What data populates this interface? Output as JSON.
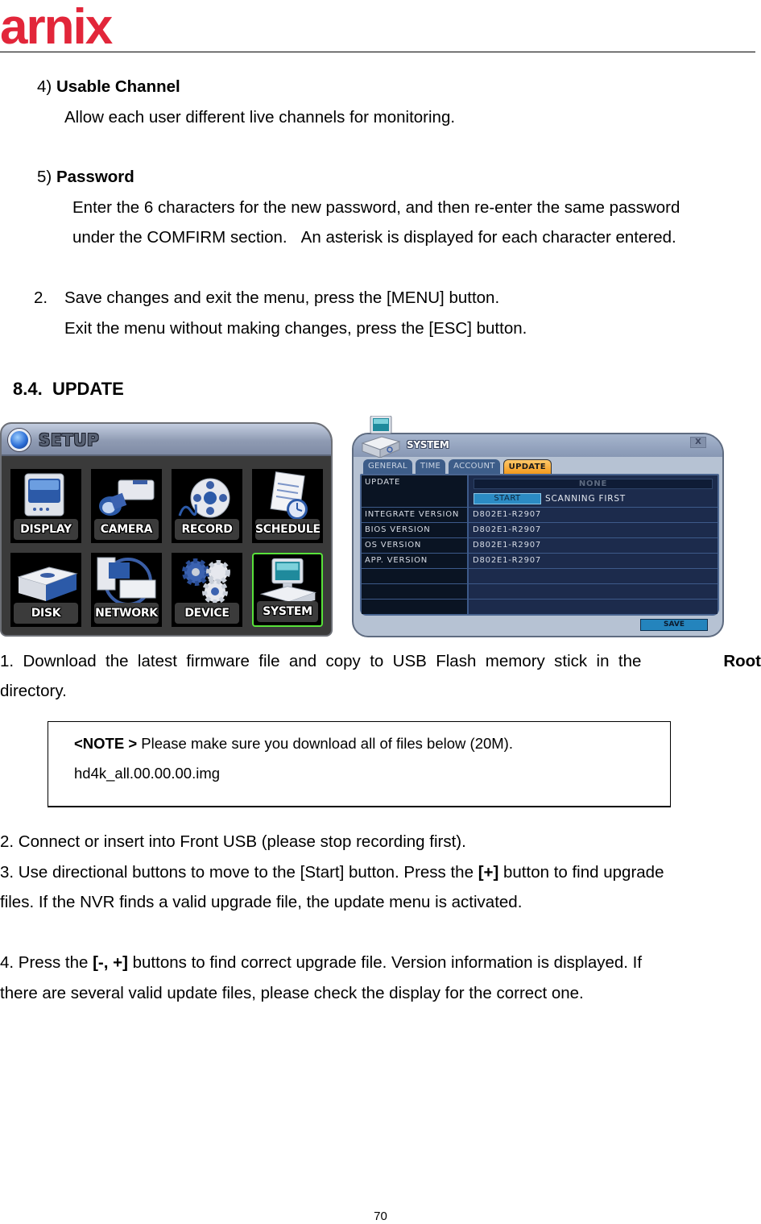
{
  "header": {
    "logo_text": "arnix",
    "brand_color": "#e2263a"
  },
  "sections": {
    "usable_channel": {
      "number": "4)",
      "title": "Usable Channel",
      "body": "Allow each user different live channels for monitoring."
    },
    "password": {
      "number": "5)",
      "title": "Password",
      "line1": "Enter the 6 characters for the new password, and then re-enter the same password",
      "line2": "under the COMFIRM section.   An asterisk is displayed for each character entered."
    },
    "step2_exit": {
      "number": "2.",
      "line1": "Save changes and exit the menu, press the [MENU] button.",
      "line2": "Exit the menu without making changes, press the [ESC] button."
    },
    "heading": {
      "number": "8.4.",
      "title": "UPDATE"
    }
  },
  "setup_menu": {
    "title": "SETUP",
    "items": [
      {
        "label": "DISPLAY",
        "icon": "monitor-icon",
        "selected": false
      },
      {
        "label": "CAMERA",
        "icon": "camera-icon",
        "selected": false
      },
      {
        "label": "RECORD",
        "icon": "film-reel-icon",
        "selected": false
      },
      {
        "label": "SCHEDULE",
        "icon": "schedule-clock-icon",
        "selected": false
      },
      {
        "label": "DISK",
        "icon": "disk-drive-icon",
        "selected": false
      },
      {
        "label": "NETWORK",
        "icon": "network-icon",
        "selected": false
      },
      {
        "label": "DEVICE",
        "icon": "gears-icon",
        "selected": false
      },
      {
        "label": "SYSTEM",
        "icon": "computer-icon",
        "selected": true
      }
    ],
    "selected_color": "#58e23a"
  },
  "system_dialog": {
    "title": "SYSTEM",
    "close_label": "X",
    "tabs": [
      {
        "label": "GENERAL",
        "active": false
      },
      {
        "label": "TIME",
        "active": false
      },
      {
        "label": "ACCOUNT",
        "active": false
      },
      {
        "label": "UPDATE",
        "active": true
      }
    ],
    "update": {
      "label": "UPDATE",
      "file_value": "NONE",
      "start_button": "START",
      "status": "SCANNING FIRST"
    },
    "rows": [
      {
        "label": "INTEGRATE VERSION",
        "value": "D802E1-R2907"
      },
      {
        "label": "BIOS VERSION",
        "value": "D802E1-R2907"
      },
      {
        "label": "OS VERSION",
        "value": "D802E1-R2907"
      },
      {
        "label": "APP. VERSION",
        "value": "D802E1-R2907"
      },
      {
        "label": "",
        "value": ""
      },
      {
        "label": "",
        "value": ""
      },
      {
        "label": "",
        "value": ""
      }
    ],
    "save_button": "SAVE",
    "active_tab_color": "#f39a1e"
  },
  "steps": {
    "step1": {
      "line1_prefix": "1.  Download  the  latest  firmware  file  and  copy  to  USB  Flash  memory  stick  in  the",
      "line1_bold": "Root",
      "line2": "directory."
    },
    "note": {
      "label": "<NOTE >",
      "text": " Please make sure you download all of files below (20M).",
      "filename": "hd4k_all.00.00.00.img"
    },
    "step2": "2. Connect or insert into Front USB (please stop recording first).",
    "step3": {
      "prefix": "3. Use directional buttons to move to the [Start] button. Press the ",
      "bold": "[+]",
      "suffix": " button to find upgrade",
      "line2": "files. If the NVR finds a valid upgrade file, the update menu is activated."
    },
    "step4": {
      "prefix": "4. Press the ",
      "bold": "[-, +]",
      "suffix": " buttons to find correct upgrade file. Version information is displayed. If",
      "line2": "there are several valid update files, please check the display for the correct one."
    }
  },
  "footer": {
    "page_number": "70"
  }
}
